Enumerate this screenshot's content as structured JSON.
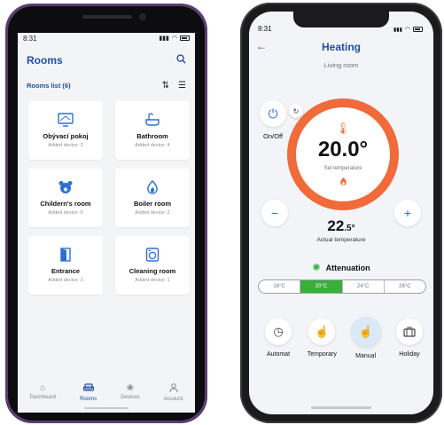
{
  "phone1": {
    "status": {
      "time": "8:31"
    },
    "header": {
      "title": "Rooms",
      "search_icon": "search-icon"
    },
    "list": {
      "label": "Rooms list (6)",
      "sort_icon": "sort-icon",
      "view_icon": "list-view-icon"
    },
    "rooms": [
      {
        "name": "Obývací pokoj",
        "devices": "Added device: 3",
        "icon": "tv-icon"
      },
      {
        "name": "Bathroom",
        "devices": "Added device: 4",
        "icon": "bathtub-icon"
      },
      {
        "name": "Childern's room",
        "devices": "Added device: 6",
        "icon": "teddy-bear-icon"
      },
      {
        "name": "Boiler room",
        "devices": "Added device: 2",
        "icon": "flame-icon"
      },
      {
        "name": "Entrance",
        "devices": "Added device: 3",
        "icon": "door-icon"
      },
      {
        "name": "Cleaning room",
        "devices": "Added device: 1",
        "icon": "washing-machine-icon"
      }
    ],
    "nav": [
      {
        "label": "Dashboard",
        "icon": "home-icon"
      },
      {
        "label": "Rooms",
        "icon": "sofa-icon"
      },
      {
        "label": "Devices",
        "icon": "devices-icon"
      },
      {
        "label": "Account",
        "icon": "user-icon"
      }
    ],
    "accent": "#1f4fa8"
  },
  "phone2": {
    "status": {
      "time": "8:31"
    },
    "header": {
      "title": "Heating",
      "subtitle": "Living room"
    },
    "power": {
      "label": "On/Off"
    },
    "setpoint": {
      "value": "20.0°",
      "label": "Set temperature"
    },
    "actual": {
      "value": "22",
      "decimal": ".5°",
      "label": "Actual temperature"
    },
    "attenuation": {
      "label": "Attenuation",
      "options": [
        "16°C",
        "20°C",
        "24°C",
        "28°C"
      ],
      "selected": "20°C"
    },
    "modes": [
      {
        "label": "Automat",
        "icon": "clock-icon"
      },
      {
        "label": "Temporary",
        "icon": "hand-timer-icon"
      },
      {
        "label": "Manual",
        "icon": "hand-pointer-icon",
        "active": true
      },
      {
        "label": "Holiday",
        "icon": "suitcase-icon"
      }
    ],
    "ring_color": "#f06a3a",
    "green": "#3cae3c"
  }
}
